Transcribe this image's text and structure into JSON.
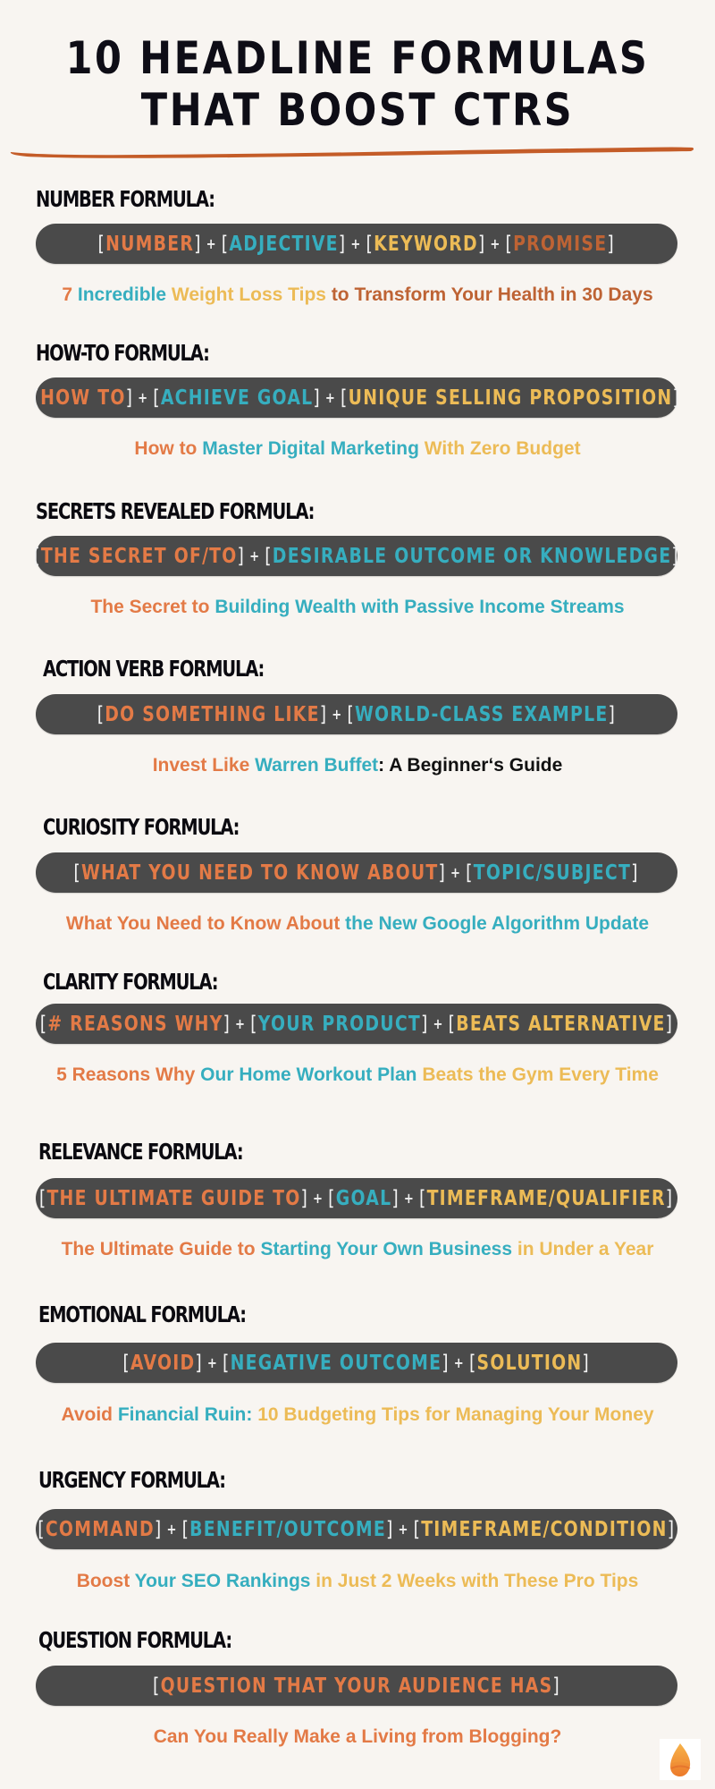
{
  "title": {
    "line1": "10 HEADLINE FORMULAS",
    "line2": "THAT BOOST CTRS"
  },
  "colors": {
    "background": "#f8f5f1",
    "pill": "#4a4a4a",
    "orange": "#e37a46",
    "teal": "#36aebf",
    "yellow": "#ecbb56",
    "rust": "#be6334",
    "underline": "#c45c28"
  },
  "formulas": [
    {
      "label": "NUMBER FORMULA:",
      "parts": [
        {
          "text": "NUMBER",
          "color": "orange"
        },
        {
          "text": "ADJECTIVE",
          "color": "teal"
        },
        {
          "text": "KEYWORD",
          "color": "yellow"
        },
        {
          "text": "PROMISE",
          "color": "rust"
        }
      ],
      "example": [
        {
          "text": "7 ",
          "color": "orange"
        },
        {
          "text": "Incredible ",
          "color": "teal"
        },
        {
          "text": "Weight Loss Tips ",
          "color": "yellow"
        },
        {
          "text": "to Transform Your Health in 30 Days",
          "color": "rust"
        }
      ]
    },
    {
      "label": "HOW-TO FORMULA:",
      "parts": [
        {
          "text": "HOW TO",
          "color": "orange"
        },
        {
          "text": "ACHIEVE GOAL",
          "color": "teal"
        },
        {
          "text": "UNIQUE SELLING PROPOSITION",
          "color": "yellow"
        }
      ],
      "example": [
        {
          "text": "How to ",
          "color": "orange"
        },
        {
          "text": "Master Digital Marketing ",
          "color": "teal"
        },
        {
          "text": "With Zero Budget",
          "color": "yellow"
        }
      ]
    },
    {
      "label": "SECRETS REVEALED FORMULA:",
      "parts": [
        {
          "text": "THE SECRET OF/TO",
          "color": "orange"
        },
        {
          "text": "DESIRABLE OUTCOME OR KNOWLEDGE",
          "color": "teal"
        }
      ],
      "example": [
        {
          "text": "The Secret to ",
          "color": "orange"
        },
        {
          "text": "Building Wealth with Passive Income Streams",
          "color": "teal"
        }
      ]
    },
    {
      "label": "ACTION VERB FORMULA:",
      "parts": [
        {
          "text": "DO SOMETHING LIKE",
          "color": "orange"
        },
        {
          "text": "WORLD-CLASS EXAMPLE",
          "color": "teal"
        }
      ],
      "example": [
        {
          "text": "Invest Like ",
          "color": "orange"
        },
        {
          "text": "Warren Buffet",
          "color": "teal"
        },
        {
          "text": ": A Beginner‘s Guide",
          "color": "black"
        }
      ]
    },
    {
      "label": "CURIOSITY FORMULA:",
      "parts": [
        {
          "text": "WHAT YOU NEED TO KNOW ABOUT",
          "color": "orange"
        },
        {
          "text": "TOPIC/SUBJECT",
          "color": "teal"
        }
      ],
      "example": [
        {
          "text": "What You Need to Know About ",
          "color": "orange"
        },
        {
          "text": "the New Google Algorithm Update",
          "color": "teal"
        }
      ]
    },
    {
      "label": "CLARITY FORMULA:",
      "parts": [
        {
          "text": "# REASONS WHY",
          "color": "orange"
        },
        {
          "text": "YOUR PRODUCT",
          "color": "teal"
        },
        {
          "text": "BEATS ALTERNATIVE",
          "color": "yellow"
        }
      ],
      "example": [
        {
          "text": "5 Reasons Why ",
          "color": "orange"
        },
        {
          "text": "Our Home Workout Plan ",
          "color": "teal"
        },
        {
          "text": "Beats the Gym Every Time",
          "color": "yellow"
        }
      ]
    },
    {
      "label": "RELEVANCE FORMULA:",
      "parts": [
        {
          "text": "THE ULTIMATE GUIDE TO",
          "color": "orange"
        },
        {
          "text": "GOAL",
          "color": "teal"
        },
        {
          "text": "TIMEFRAME/QUALIFIER",
          "color": "yellow"
        }
      ],
      "example": [
        {
          "text": "The Ultimate Guide to ",
          "color": "orange"
        },
        {
          "text": "Starting Your Own Business ",
          "color": "teal"
        },
        {
          "text": "in Under a Year",
          "color": "yellow"
        }
      ]
    },
    {
      "label": "EMOTIONAL FORMULA:",
      "parts": [
        {
          "text": "AVOID",
          "color": "orange"
        },
        {
          "text": "NEGATIVE OUTCOME",
          "color": "teal"
        },
        {
          "text": "SOLUTION",
          "color": "yellow"
        }
      ],
      "example": [
        {
          "text": "Avoid ",
          "color": "orange"
        },
        {
          "text": "Financial Ruin: ",
          "color": "teal"
        },
        {
          "text": "10 Budgeting Tips for Managing Your Money",
          "color": "yellow"
        }
      ]
    },
    {
      "label": "URGENCY FORMULA:",
      "parts": [
        {
          "text": "COMMAND",
          "color": "orange"
        },
        {
          "text": "BENEFIT/OUTCOME",
          "color": "teal"
        },
        {
          "text": "TIMEFRAME/CONDITION",
          "color": "yellow"
        }
      ],
      "example": [
        {
          "text": "Boost ",
          "color": "orange"
        },
        {
          "text": "Your SEO Rankings ",
          "color": "teal"
        },
        {
          "text": "in Just 2 Weeks with These Pro Tips",
          "color": "yellow"
        }
      ]
    },
    {
      "label": "QUESTION FORMULA:",
      "parts": [
        {
          "text": "QUESTION THAT YOUR AUDIENCE HAS",
          "color": "orange"
        }
      ],
      "example": [
        {
          "text": "Can You Really Make a Living from Blogging?",
          "color": "orange"
        }
      ]
    }
  ],
  "separator": "+",
  "logo": {
    "icon": "flame-drop-logo-icon"
  }
}
